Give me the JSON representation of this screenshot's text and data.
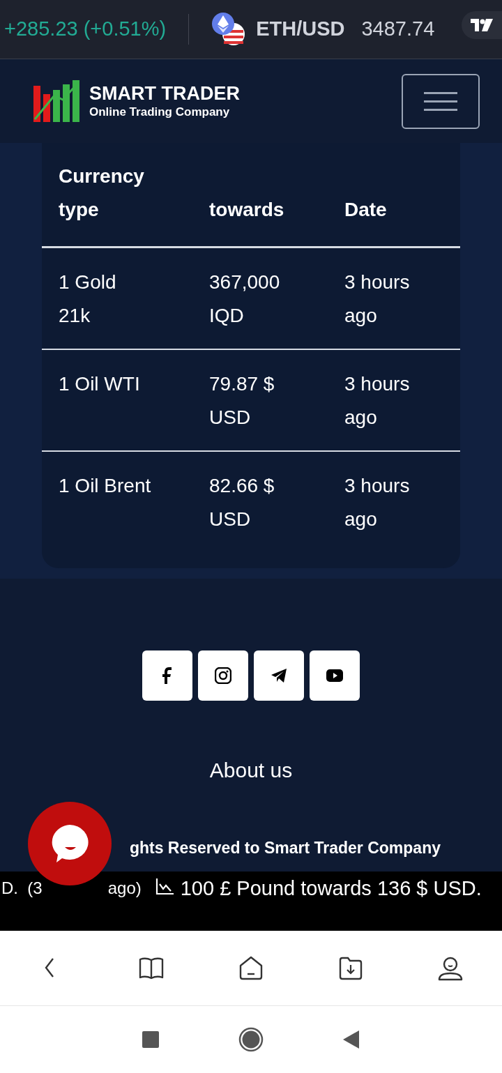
{
  "price_ticker": [
    {
      "kind": "change",
      "text": "+285.23 (+0.51%)"
    },
    {
      "kind": "pair",
      "symbol": "ETH/USD",
      "price": "3487.74"
    }
  ],
  "header": {
    "brand": "SMART TRADER",
    "tagline": "Online Trading Company"
  },
  "table": {
    "columns": [
      "Currency type",
      "towards",
      "Date"
    ],
    "rows": [
      [
        "1 Gold 21k",
        "367,000 IQD",
        "3 hours ago"
      ],
      [
        "1 Oil WTI",
        "79.87 $ USD",
        "3 hours ago"
      ],
      [
        "1 Oil Brent",
        "82.66 $ USD",
        "3 hours ago"
      ]
    ]
  },
  "social": [
    {
      "kind": "facebook"
    },
    {
      "kind": "instagram"
    },
    {
      "kind": "telegram"
    },
    {
      "kind": "youtube"
    }
  ],
  "footer": {
    "link": "About us",
    "copyright": "ghts Reserved to Smart Trader Company"
  },
  "news_ticker": {
    "fragments": [
      "D.  (3",
      "ago)"
    ],
    "item": "100 £ Pound towards 136 $ USD."
  },
  "browser_bar": [
    {
      "kind": "back"
    },
    {
      "kind": "book"
    },
    {
      "kind": "home"
    },
    {
      "kind": "downloads"
    },
    {
      "kind": "profile"
    }
  ],
  "system_nav": [
    {
      "kind": "recents"
    },
    {
      "kind": "home"
    },
    {
      "kind": "back"
    }
  ]
}
